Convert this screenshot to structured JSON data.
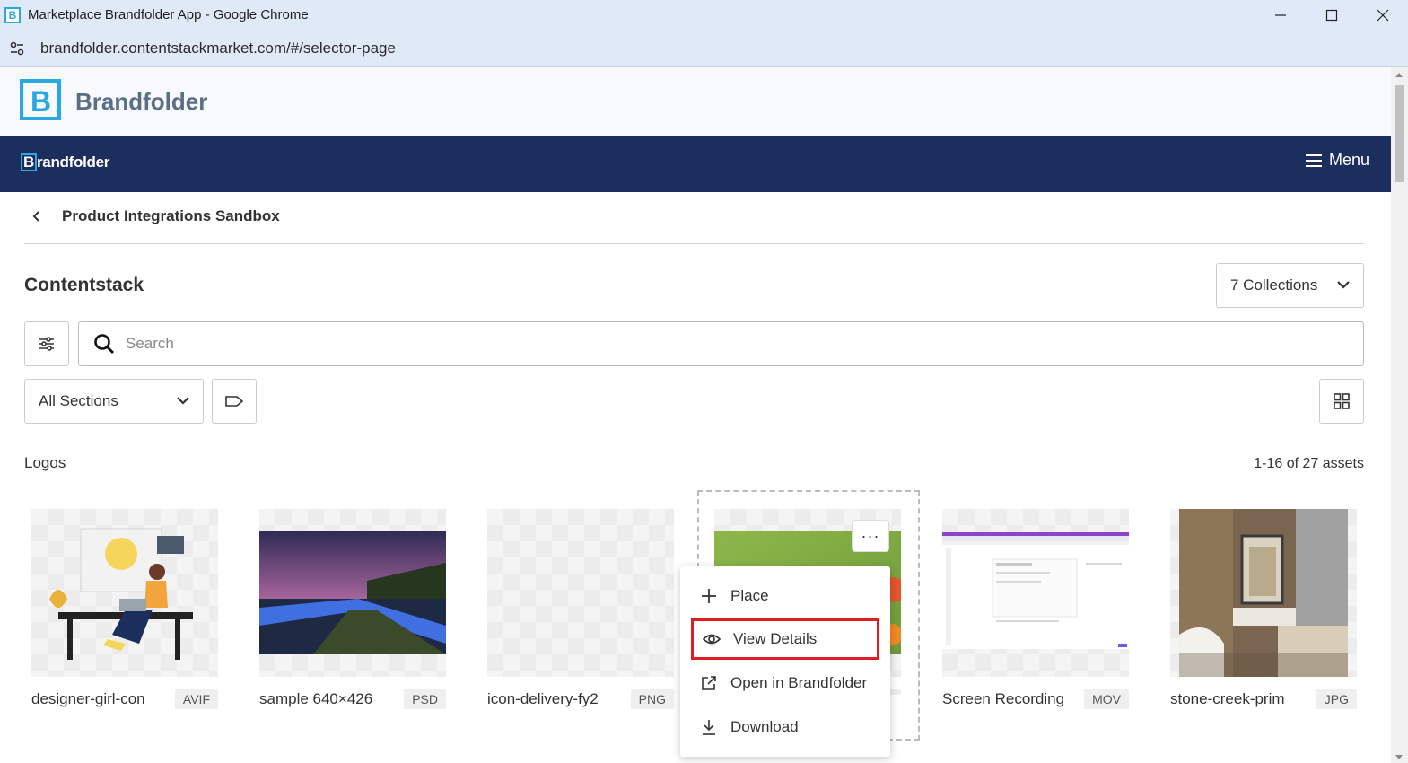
{
  "browser": {
    "window_title": "Marketplace Brandfolder App - Google Chrome",
    "app_icon_letter": "B",
    "url": "brandfolder.contentstackmarket.com/#/selector-page"
  },
  "app": {
    "logo_text": "Brandfolder",
    "nav_brand_text": "randfolder",
    "nav_brand_letter": "B",
    "menu_label": "Menu"
  },
  "breadcrumb": {
    "label": "Product Integrations Sandbox"
  },
  "section": {
    "title": "Contentstack",
    "collections_label": "7 Collections"
  },
  "search": {
    "placeholder": "Search"
  },
  "filters": {
    "sections_label": "All Sections"
  },
  "group": {
    "label": "Logos",
    "asset_count": "1-16 of 27 assets"
  },
  "assets": [
    {
      "name": "designer-girl-con",
      "type": "AVIF"
    },
    {
      "name": "sample 640×426",
      "type": "PSD"
    },
    {
      "name": "icon-delivery-fy2",
      "type": "PNG"
    },
    {
      "name": "",
      "type": ""
    },
    {
      "name": "Screen Recording",
      "type": "MOV"
    },
    {
      "name": "stone-creek-prim",
      "type": "JPG"
    }
  ],
  "context_menu": {
    "items": [
      {
        "label": "Place",
        "icon": "plus-icon"
      },
      {
        "label": "View Details",
        "icon": "eye-icon",
        "highlighted": true
      },
      {
        "label": "Open in Brandfolder",
        "icon": "external-link-icon"
      },
      {
        "label": "Download",
        "icon": "download-icon"
      }
    ],
    "more_label": "···"
  },
  "colors": {
    "navbar": "#1c2e5e",
    "brand_accent": "#2aa9e0",
    "highlight_border": "#e01b22"
  }
}
